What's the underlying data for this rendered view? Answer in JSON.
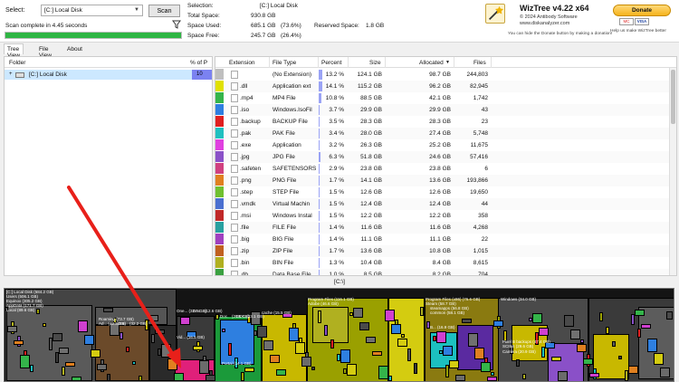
{
  "header": {
    "select_label": "Select:",
    "drive_value": "[C:] Local Disk",
    "scan_label": "Scan",
    "scan_status": "Scan complete in 4.45 seconds",
    "progress_fraction": 1.0,
    "progress_color": "#2fb544"
  },
  "stats": {
    "selection_label": "Selection:",
    "selection_value": "[C:]  Local Disk",
    "total_label": "Total Space:",
    "total_value": "930.8 GB",
    "used_label": "Space Used:",
    "used_value": "685.1 GB",
    "used_pct": "(73.6%)",
    "used_fraction": 0.736,
    "free_label": "Space Free:",
    "free_value": "245.7 GB",
    "free_pct": "(26.4%)",
    "free_fraction": 0.264,
    "reserved_label": "Reserved Space:",
    "reserved_value": "1.8 GB"
  },
  "branding": {
    "title": "WizTree v4.22 x64",
    "copyright": "© 2024 Antibody Software",
    "website": "www.diskanalyzer.com",
    "donate_note": "You can hide the Donate button by making a donation!",
    "donate_label": "Donate",
    "help_text": "Help us make WizTree better",
    "card1": "MC",
    "card2": "VISA"
  },
  "tabs": [
    {
      "label": "Tree View"
    },
    {
      "label": "File View"
    },
    {
      "label": "About"
    }
  ],
  "tree": {
    "col_folder": "Folder",
    "col_pct": "% of P",
    "row_label": "[C:] Local Disk",
    "row_pct": "10"
  },
  "ext_table": {
    "headers": {
      "extension": "Extension",
      "file_type": "File Type",
      "percent": "Percent",
      "size": "Size",
      "allocated": "Allocated",
      "files": "Files"
    },
    "rows": [
      {
        "color": "#bfbfbf",
        "ext": "",
        "type": "(No Extension)",
        "pct": "13.2 %",
        "pct_value": 13.2,
        "size": "124.1 GB",
        "alloc": "98.7 GB",
        "files": "244,803"
      },
      {
        "color": "#e0e000",
        "ext": ".dll",
        "type": "Application ext",
        "pct": "14.1 %",
        "pct_value": 14.1,
        "size": "115.2 GB",
        "alloc": "96.2 GB",
        "files": "82,945"
      },
      {
        "color": "#34b44a",
        "ext": ".mp4",
        "type": "MP4 File",
        "pct": "10.8 %",
        "pct_value": 10.8,
        "size": "88.5 GB",
        "alloc": "42.1 GB",
        "files": "1,742"
      },
      {
        "color": "#2e7fe0",
        "ext": ".iso",
        "type": "Windows.IsoFil",
        "pct": "3.7 %",
        "pct_value": 3.7,
        "size": "29.9 GB",
        "alloc": "29.9 GB",
        "files": "43"
      },
      {
        "color": "#e02020",
        "ext": ".backup",
        "type": "BACKUP File",
        "pct": "3.5 %",
        "pct_value": 3.5,
        "size": "28.3 GB",
        "alloc": "28.3 GB",
        "files": "23"
      },
      {
        "color": "#20c0c0",
        "ext": ".pak",
        "type": "PAK File",
        "pct": "3.4 %",
        "pct_value": 3.4,
        "size": "28.0 GB",
        "alloc": "27.4 GB",
        "files": "5,748"
      },
      {
        "color": "#e040e0",
        "ext": ".exe",
        "type": "Application",
        "pct": "3.2 %",
        "pct_value": 3.2,
        "size": "26.3 GB",
        "alloc": "25.2 GB",
        "files": "11,675"
      },
      {
        "color": "#8a50c8",
        "ext": ".jpg",
        "type": "JPG File",
        "pct": "6.3 %",
        "pct_value": 6.3,
        "size": "51.8 GB",
        "alloc": "24.6 GB",
        "files": "57,416"
      },
      {
        "color": "#d04080",
        "ext": ".safeten",
        "type": "SAFETENSORS",
        "pct": "2.9 %",
        "pct_value": 2.9,
        "size": "23.8 GB",
        "alloc": "23.8 GB",
        "files": "6"
      },
      {
        "color": "#e08020",
        "ext": ".png",
        "type": "PNG File",
        "pct": "1.7 %",
        "pct_value": 1.7,
        "size": "14.1 GB",
        "alloc": "13.6 GB",
        "files": "193,866"
      },
      {
        "color": "#70c030",
        "ext": ".step",
        "type": "STEP File",
        "pct": "1.5 %",
        "pct_value": 1.5,
        "size": "12.6 GB",
        "alloc": "12.6 GB",
        "files": "19,650"
      },
      {
        "color": "#4a6fd0",
        "ext": ".vmdk",
        "type": "Virtual Machin",
        "pct": "1.5 %",
        "pct_value": 1.5,
        "size": "12.4 GB",
        "alloc": "12.4 GB",
        "files": "44"
      },
      {
        "color": "#c02828",
        "ext": ".msi",
        "type": "Windows Instal",
        "pct": "1.5 %",
        "pct_value": 1.5,
        "size": "12.2 GB",
        "alloc": "12.2 GB",
        "files": "358"
      },
      {
        "color": "#28a0a0",
        "ext": ".file",
        "type": "FILE File",
        "pct": "1.4 %",
        "pct_value": 1.4,
        "size": "11.6 GB",
        "alloc": "11.6 GB",
        "files": "4,268"
      },
      {
        "color": "#a040c0",
        "ext": ".big",
        "type": "BIG File",
        "pct": "1.4 %",
        "pct_value": 1.4,
        "size": "11.1 GB",
        "alloc": "11.1 GB",
        "files": "22"
      },
      {
        "color": "#c06020",
        "ext": ".zip",
        "type": "ZIP File",
        "pct": "1.7 %",
        "pct_value": 1.7,
        "size": "13.6 GB",
        "alloc": "10.8 GB",
        "files": "1,015"
      },
      {
        "color": "#b0b020",
        "ext": ".bin",
        "type": "BIN File",
        "pct": "1.3 %",
        "pct_value": 1.3,
        "size": "10.4 GB",
        "alloc": "8.4 GB",
        "files": "8,615"
      },
      {
        "color": "#3aa040",
        "ext": ".db",
        "type": "Data Base File",
        "pct": "1.0 %",
        "pct_value": 1.0,
        "size": "8.5 GB",
        "alloc": "8.2 GB",
        "files": "704"
      }
    ]
  },
  "path_bar": "[C:\\]",
  "treemap": {
    "labels": [
      "[C:] Local Disk (684.2 GB)",
      "Users (506.1 GB)",
      "Equinox (305.2 GB)",
      "AppData (171.7 GB)",
      "Local (89.6 GB)",
      "Roaming (73.7 GB)",
      "Ad... (42.3 GB)",
      "Doc... (32.2 GB)",
      "One... (32.6 GB)",
      "Doc... (12.6 GB)",
      "Vid... (16.5 GB)",
      "Doc... (20.5 GB)",
      "DOC (23.1 GB)",
      "cache (15.5 GB)",
      "Portal (14.1 GB)",
      "Program Files (116.1 GB)",
      "Adobe (46.6 GB)",
      "Program Files (x86) (76.6 GB)",
      "Steam (58.7 GB)",
      "steamapps (56.8 GB)",
      "common (58.1 GB)",
      "B... (16.9 GB)",
      "Windows (34.0 GB)",
      "Pixel B backups (47.4 GB)",
      "SCIBS (29.6 GB)",
      "Camera (20.9 GB)"
    ]
  }
}
